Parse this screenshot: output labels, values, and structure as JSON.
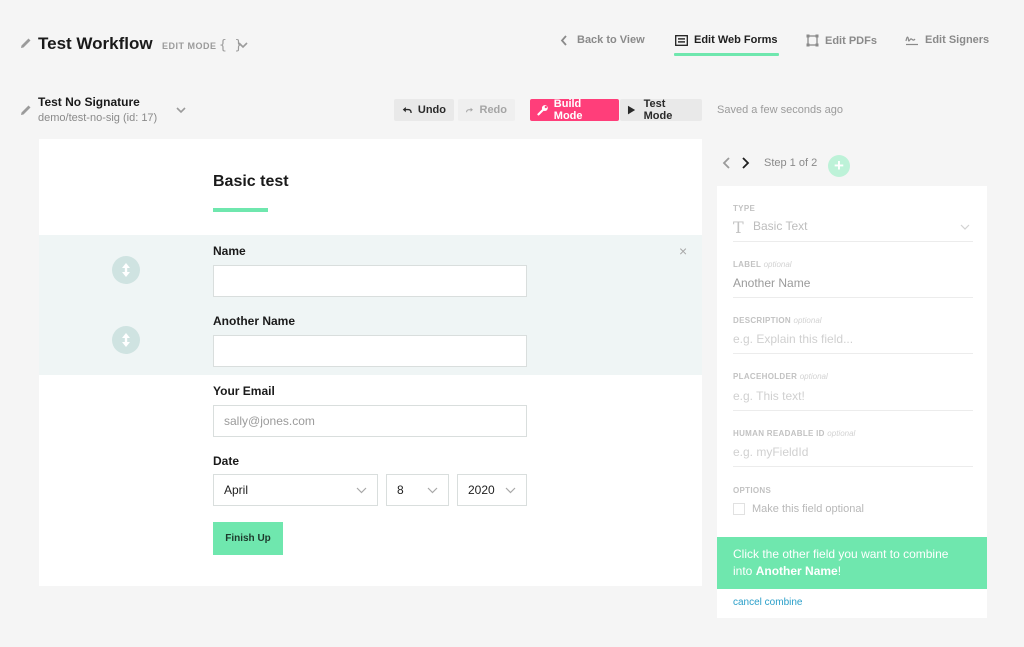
{
  "header": {
    "workflow_title": "Test Workflow",
    "edit_mode": "EDIT MODE",
    "braces": "{ }",
    "nav": {
      "back": "Back to View",
      "web_forms": "Edit Web Forms",
      "pdfs": "Edit PDFs",
      "signers": "Edit Signers"
    }
  },
  "subheader": {
    "form_name": "Test No Signature",
    "form_path": "demo/test-no-sig (id: 17)",
    "undo": "Undo",
    "redo": "Redo",
    "build_mode": "Build Mode",
    "test_mode": "Test Mode",
    "saved": "Saved a few seconds ago"
  },
  "form": {
    "title": "Basic test",
    "fields": [
      {
        "label": "Name",
        "value": ""
      },
      {
        "label": "Another Name",
        "value": ""
      },
      {
        "label": "Your Email",
        "placeholder": "sally@jones.com"
      }
    ],
    "date": {
      "label": "Date",
      "month": "April",
      "day": "8",
      "year": "2020"
    },
    "finish": "Finish Up",
    "close": "×"
  },
  "panel": {
    "step": "Step 1 of 2",
    "type_label": "TYPE",
    "type_value": "Basic Text",
    "label_label": "LABEL",
    "optional": "optional",
    "label_value": "Another Name",
    "description_label": "DESCRIPTION",
    "description_placeholder": "e.g. Explain this field...",
    "placeholder_label": "PLACEHOLDER",
    "placeholder_placeholder": "e.g. This text!",
    "hrid_label": "HUMAN READABLE ID",
    "hrid_placeholder": "e.g. myFieldId",
    "options_label": "OPTIONS",
    "optional_checkbox": "Make this field optional",
    "combine_prefix": "Click the other field you want to combine into",
    "combine_target": "Another Name",
    "combine_suffix": "!",
    "cancel_combine": "cancel combine"
  },
  "colors": {
    "accent": "#6fe7ae",
    "build_mode": "#ff3e7a",
    "link": "#2a9fc9"
  }
}
